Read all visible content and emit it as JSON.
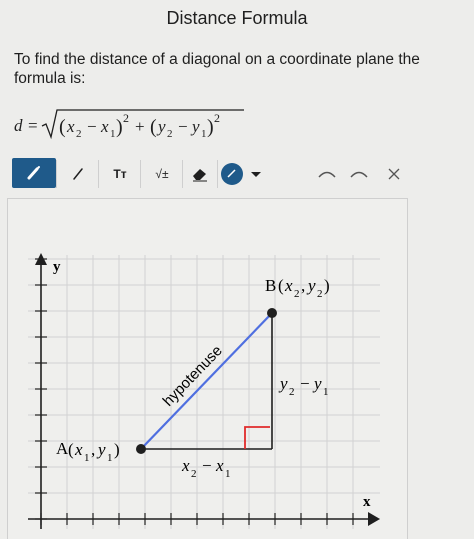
{
  "title": "Distance Formula",
  "intro": "To find the distance of a diagonal on a coordinate plane the formula is:",
  "formula": {
    "d": "d",
    "equals": "=",
    "x2": "x",
    "x2_sub": "2",
    "minus": "−",
    "x1": "x",
    "x1_sub": "1",
    "sq": "2",
    "plus": "+",
    "y2": "y",
    "y2_sub": "2",
    "y1": "y",
    "y1_sub": "1"
  },
  "toolbar": {
    "text_tool_label": "Tт",
    "root_tool_label": "√±"
  },
  "graph": {
    "y_axis_label": "y",
    "x_axis_label": "x",
    "point_a_label": "A",
    "point_a_x": "x",
    "point_a_x_sub": "1",
    "point_a_y": "y",
    "point_a_y_sub": "1",
    "point_b_label": "B",
    "point_b_x": "x",
    "point_b_x_sub": "2",
    "point_b_y": "y",
    "point_b_y_sub": "2",
    "hypotenuse_label": "hypotenuse",
    "vertical_leg": "y₂ − y₁",
    "horizontal_leg": "x₂ − x₁",
    "vertical_leg_a": "y",
    "vertical_leg_a_sub": "2",
    "vertical_leg_minus": "−",
    "vertical_leg_b": "y",
    "vertical_leg_b_sub": "1",
    "horizontal_leg_a": "x",
    "horizontal_leg_a_sub": "2",
    "horizontal_leg_minus": "−",
    "horizontal_leg_b": "x",
    "horizontal_leg_b_sub": "1"
  },
  "colors": {
    "accent": "#1f5a8a",
    "hypotenuse": "#4f6fe0",
    "right_angle": "#e02b2b",
    "text": "#1f1f1f",
    "grid": "#cfcfcf"
  },
  "icons": {
    "pen": "pen-icon",
    "line": "line-icon",
    "eraser": "eraser-icon",
    "color": "color-picker-icon",
    "undo": "undo-icon",
    "redo": "redo-icon",
    "close": "close-icon"
  }
}
